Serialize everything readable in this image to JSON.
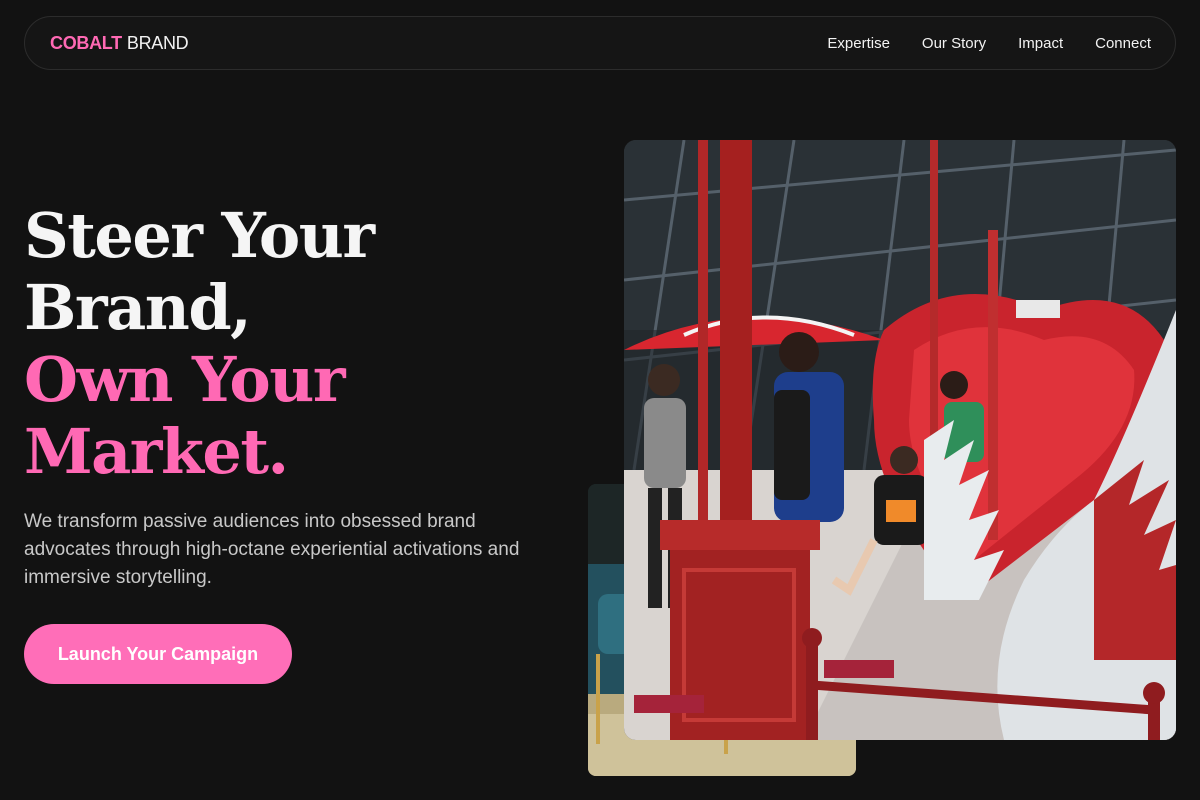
{
  "brand": {
    "accent": "COBALT",
    "rest": "BRAND"
  },
  "nav": {
    "links": [
      "Expertise",
      "Our Story",
      "Impact",
      "Connect"
    ]
  },
  "hero": {
    "title_lines": [
      "Steer Your",
      "Brand,",
      "Own Your",
      "Market."
    ],
    "description": "We transform passive audiences into obsessed brand advocates through high-octane experiential activations and immersive storytelling.",
    "cta_label": "Launch Your Campaign"
  },
  "colors": {
    "accent": "#ff69b4",
    "background": "#121212",
    "cta": "#ff6eb8"
  }
}
